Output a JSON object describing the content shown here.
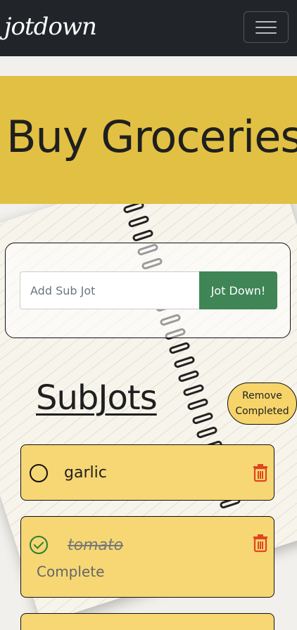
{
  "brand": "jotdown",
  "jot_title": "Buy Groceries",
  "add_form": {
    "placeholder": "Add Sub Jot",
    "submit_label": "Jot Down!"
  },
  "subjots_heading": "SubJots",
  "remove_completed_label": "Remove Completed",
  "subjots": [
    {
      "text": "garlic",
      "completed": false,
      "status": ""
    },
    {
      "text": "tomato",
      "completed": true,
      "status": "Complete"
    }
  ],
  "colors": {
    "navbar": "#212529",
    "banner": "#e2c043",
    "submit_button": "#3f8556",
    "card": "#f6d774",
    "delete_icon": "#e0451f",
    "check_done": "#2e7d32"
  },
  "icons": {
    "menu": "hamburger-icon",
    "check": "circle-check-icon",
    "delete": "trash-icon"
  }
}
